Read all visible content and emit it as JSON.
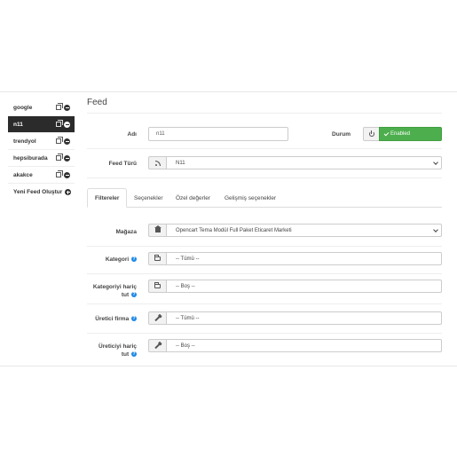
{
  "sidebar": {
    "items": [
      {
        "label": "google"
      },
      {
        "label": "n11"
      },
      {
        "label": "trendyol"
      },
      {
        "label": "hepsiburada"
      },
      {
        "label": "akakce"
      }
    ],
    "new_label": "Yeni Feed Oluştur"
  },
  "main": {
    "title": "Feed",
    "name_label": "Adı",
    "name_value": "n11",
    "status_label": "Durum",
    "status_value": "Enabled",
    "feed_type_label": "Feed Türü",
    "feed_type_value": "N11",
    "tabs": [
      {
        "label": "Filtereler"
      },
      {
        "label": "Seçenekler"
      },
      {
        "label": "Özel değerler"
      },
      {
        "label": "Gelişmiş seçenekler"
      }
    ],
    "store_label": "Mağaza",
    "store_value": "Opencart Tema Modül Full Paket Eticaret Marketi",
    "category_label": "Kategori",
    "category_value": "-- Tümü --",
    "category_exclude_label_1": "Kategoriyi hariç",
    "category_exclude_label_2": "tut",
    "category_exclude_value": "-- Boş --",
    "manufacturer_label": "Üretici firma",
    "manufacturer_value": "-- Tümü --",
    "manufacturer_exclude_label_1": "Üreticiyi hariç",
    "manufacturer_exclude_label_2": "tut",
    "manufacturer_exclude_value": "-- Boş --",
    "help_glyph": "?"
  },
  "colors": {
    "active_sidebar": "#2b2b2b",
    "enabled_green": "#4cae4c",
    "help_blue": "#1e88e5"
  }
}
